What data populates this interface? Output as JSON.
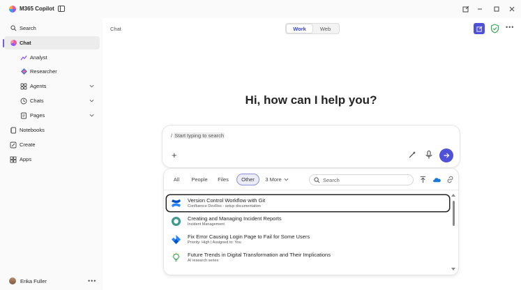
{
  "app": {
    "title": "M365 Copilot",
    "logo_icon": "copilot-logo-icon"
  },
  "window_controls": [
    "edit-icon",
    "minimize-icon",
    "maximize-icon",
    "close-icon"
  ],
  "sidebar": {
    "search_label": "Search",
    "items": [
      {
        "label": "Chat",
        "icon": "chat-icon",
        "active": true
      },
      {
        "label": "Analyst",
        "icon": "analyst-icon",
        "sub": true
      },
      {
        "label": "Researcher",
        "icon": "researcher-icon",
        "sub": true
      },
      {
        "label": "Agents",
        "icon": "agents-icon",
        "expandable": true
      },
      {
        "label": "Chats",
        "icon": "chats-icon",
        "expandable": true
      },
      {
        "label": "Pages",
        "icon": "pages-icon",
        "expandable": true
      },
      {
        "label": "Notebooks",
        "icon": "notebook-icon"
      },
      {
        "label": "Create",
        "icon": "create-icon"
      },
      {
        "label": "Apps",
        "icon": "apps-icon"
      }
    ],
    "user": {
      "name": "Erika Fuller",
      "more": "•••"
    }
  },
  "main": {
    "breadcrumb": "Chat",
    "toggle": {
      "work": "Work",
      "web": "Web",
      "selected": "Work"
    },
    "more": "•••",
    "greeting": "Hi, how can I help you?",
    "composer": {
      "slash": "/",
      "prompt": "Start typing to search"
    }
  },
  "picker": {
    "filters": [
      "All",
      "People",
      "Files",
      "Other",
      "3 More"
    ],
    "selected_filter": "Other",
    "search_placeholder": "Search",
    "results": [
      {
        "title": "Version Control Workflow with Git",
        "subtitle": "Confluence DevRes - setup documentation",
        "icon": "confluence-icon",
        "selected": true
      },
      {
        "title": "Creating and Managing Incident Reports",
        "subtitle": "Incident Management",
        "icon": "incident-icon",
        "selected": false
      },
      {
        "title": "Fix Error Causing Login Page to Fail for Some Users",
        "subtitle": "Priority: High | Assigned to: You",
        "icon": "jira-icon",
        "selected": false
      },
      {
        "title": "Future Trends in Digital Transformation and Their Implications",
        "subtitle": "AI research series",
        "icon": "lightbulb-icon",
        "selected": false
      }
    ]
  },
  "colors": {
    "accent": "#4f52d8",
    "active_bar": "#7a5ae0",
    "shield": "#3aa655"
  }
}
